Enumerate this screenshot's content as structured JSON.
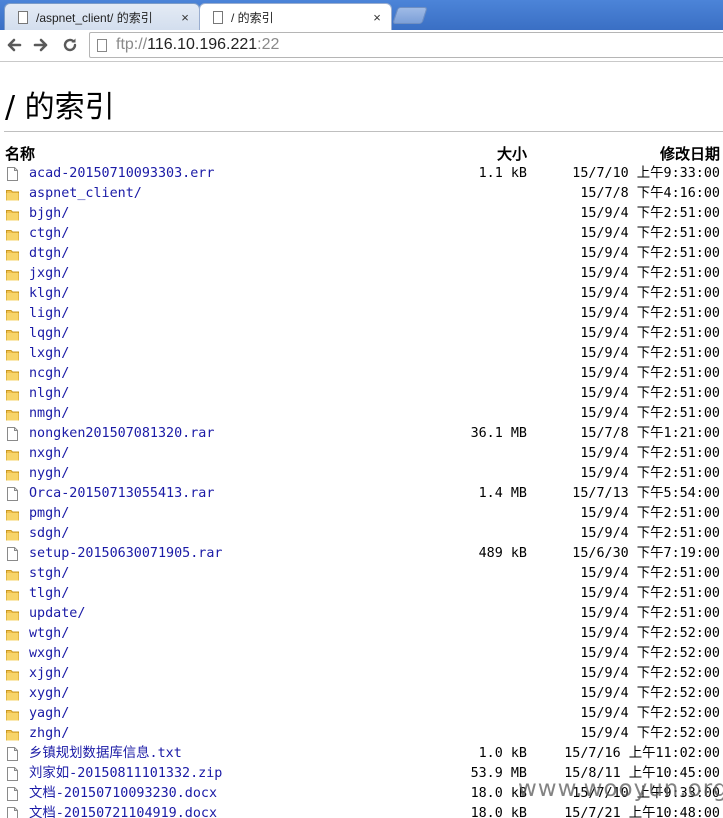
{
  "browser": {
    "tabs": [
      {
        "title": "/aspnet_client/ 的索引",
        "active": false
      },
      {
        "title": "/ 的索引",
        "active": true
      }
    ],
    "close_glyph": "×",
    "address": {
      "scheme": "ftp://",
      "host": "116.10.196.221",
      "port": ":22"
    },
    "icons": {
      "back": "back-arrow-icon",
      "forward": "forward-arrow-icon",
      "reload": "reload-icon",
      "page": "page-icon"
    }
  },
  "page": {
    "title": "/ 的索引",
    "columns": {
      "name": "名称",
      "size": "大小",
      "date": "修改日期"
    }
  },
  "files": [
    {
      "type": "file",
      "name": "acad-20150710093303.err",
      "size": "1.1 kB",
      "date": "15/7/10 上午9:33:00"
    },
    {
      "type": "folder",
      "name": "aspnet_client/",
      "size": "",
      "date": "15/7/8 下午4:16:00"
    },
    {
      "type": "folder",
      "name": "bjgh/",
      "size": "",
      "date": "15/9/4 下午2:51:00"
    },
    {
      "type": "folder",
      "name": "ctgh/",
      "size": "",
      "date": "15/9/4 下午2:51:00"
    },
    {
      "type": "folder",
      "name": "dtgh/",
      "size": "",
      "date": "15/9/4 下午2:51:00"
    },
    {
      "type": "folder",
      "name": "jxgh/",
      "size": "",
      "date": "15/9/4 下午2:51:00"
    },
    {
      "type": "folder",
      "name": "klgh/",
      "size": "",
      "date": "15/9/4 下午2:51:00"
    },
    {
      "type": "folder",
      "name": "ligh/",
      "size": "",
      "date": "15/9/4 下午2:51:00"
    },
    {
      "type": "folder",
      "name": "lqgh/",
      "size": "",
      "date": "15/9/4 下午2:51:00"
    },
    {
      "type": "folder",
      "name": "lxgh/",
      "size": "",
      "date": "15/9/4 下午2:51:00"
    },
    {
      "type": "folder",
      "name": "ncgh/",
      "size": "",
      "date": "15/9/4 下午2:51:00"
    },
    {
      "type": "folder",
      "name": "nlgh/",
      "size": "",
      "date": "15/9/4 下午2:51:00"
    },
    {
      "type": "folder",
      "name": "nmgh/",
      "size": "",
      "date": "15/9/4 下午2:51:00"
    },
    {
      "type": "file",
      "name": "nongken201507081320.rar",
      "size": "36.1 MB",
      "date": "15/7/8 下午1:21:00"
    },
    {
      "type": "folder",
      "name": "nxgh/",
      "size": "",
      "date": "15/9/4 下午2:51:00"
    },
    {
      "type": "folder",
      "name": "nygh/",
      "size": "",
      "date": "15/9/4 下午2:51:00"
    },
    {
      "type": "file",
      "name": "Orca-20150713055413.rar",
      "size": "1.4 MB",
      "date": "15/7/13 下午5:54:00"
    },
    {
      "type": "folder",
      "name": "pmgh/",
      "size": "",
      "date": "15/9/4 下午2:51:00"
    },
    {
      "type": "folder",
      "name": "sdgh/",
      "size": "",
      "date": "15/9/4 下午2:51:00"
    },
    {
      "type": "file",
      "name": "setup-20150630071905.rar",
      "size": "489 kB",
      "date": "15/6/30 下午7:19:00"
    },
    {
      "type": "folder",
      "name": "stgh/",
      "size": "",
      "date": "15/9/4 下午2:51:00"
    },
    {
      "type": "folder",
      "name": "tlgh/",
      "size": "",
      "date": "15/9/4 下午2:51:00"
    },
    {
      "type": "folder",
      "name": "update/",
      "size": "",
      "date": "15/9/4 下午2:51:00"
    },
    {
      "type": "folder",
      "name": "wtgh/",
      "size": "",
      "date": "15/9/4 下午2:52:00"
    },
    {
      "type": "folder",
      "name": "wxgh/",
      "size": "",
      "date": "15/9/4 下午2:52:00"
    },
    {
      "type": "folder",
      "name": "xjgh/",
      "size": "",
      "date": "15/9/4 下午2:52:00"
    },
    {
      "type": "folder",
      "name": "xygh/",
      "size": "",
      "date": "15/9/4 下午2:52:00"
    },
    {
      "type": "folder",
      "name": "yagh/",
      "size": "",
      "date": "15/9/4 下午2:52:00"
    },
    {
      "type": "folder",
      "name": "zhgh/",
      "size": "",
      "date": "15/9/4 下午2:52:00"
    },
    {
      "type": "file",
      "name": "乡镇规划数据库信息.txt",
      "size": "1.0 kB",
      "date": "15/7/16 上午11:02:00"
    },
    {
      "type": "file",
      "name": "刘家如-20150811101332.zip",
      "size": "53.9 MB",
      "date": "15/8/11 上午10:45:00"
    },
    {
      "type": "file",
      "name": "文档-20150710093230.docx",
      "size": "18.0 kB",
      "date": "15/7/10 上午9:33:00"
    },
    {
      "type": "file",
      "name": "文档-20150721104919.docx",
      "size": "18.0 kB",
      "date": "15/7/21 上午10:48:00"
    }
  ],
  "watermark": "www.wooyun.org",
  "colors": {
    "link": "#1a1aa6",
    "folder": "#f2c14e",
    "tabstrip": "#3a6fc4"
  }
}
